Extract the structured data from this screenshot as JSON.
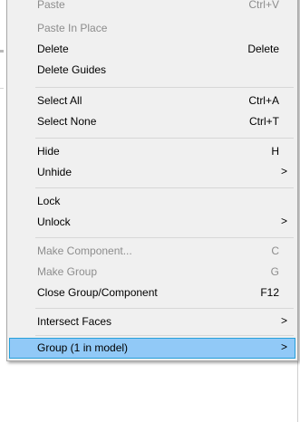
{
  "menu": {
    "paste": {
      "label": "Paste",
      "shortcut": "Ctrl+V"
    },
    "paste_in_place": {
      "label": "Paste In Place"
    },
    "delete": {
      "label": "Delete",
      "shortcut": "Delete"
    },
    "delete_guides": {
      "label": "Delete Guides"
    },
    "select_all": {
      "label": "Select All",
      "shortcut": "Ctrl+A"
    },
    "select_none": {
      "label": "Select None",
      "shortcut": "Ctrl+T"
    },
    "hide": {
      "label": "Hide",
      "shortcut": "H"
    },
    "unhide": {
      "label": "Unhide",
      "submenu_arrow": ">"
    },
    "lock": {
      "label": "Lock"
    },
    "unlock": {
      "label": "Unlock",
      "submenu_arrow": ">"
    },
    "make_component": {
      "label": "Make Component...",
      "shortcut": "C"
    },
    "make_group": {
      "label": "Make Group",
      "shortcut": "G"
    },
    "close_group": {
      "label": "Close Group/Component",
      "shortcut": "F12"
    },
    "intersect_faces": {
      "label": "Intersect Faces",
      "submenu_arrow": ">"
    },
    "group": {
      "label": "Group (1 in model)",
      "submenu_arrow": ">"
    }
  },
  "colors": {
    "menu_background": "#f0f0f0",
    "highlight_fill": "#91c9f7",
    "highlight_border": "#26a0da",
    "disabled_text": "#8d8d8d"
  }
}
